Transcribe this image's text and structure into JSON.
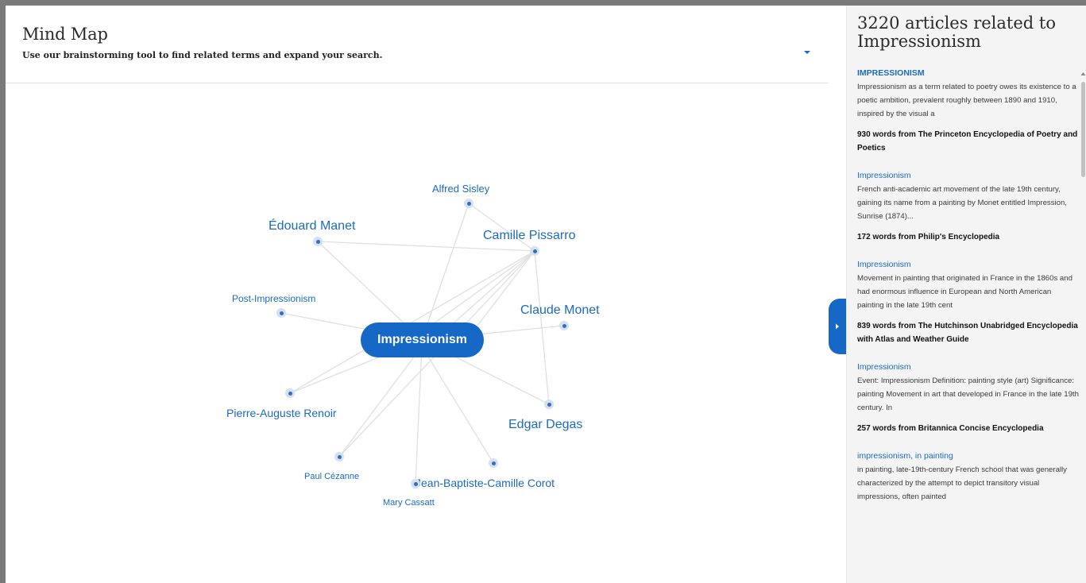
{
  "mindmap": {
    "title": "Mind Map",
    "subtitle": "Use our brainstorming tool to find related terms and expand your search.",
    "center": "Impressionism",
    "nodes": {
      "sisley": "Alfred Sisley",
      "manet": "Édouard Manet",
      "pissarro": "Camille Pissarro",
      "post": "Post-Impressionism",
      "monet": "Claude Monet",
      "renoir": "Pierre-Auguste Renoir",
      "degas": "Edgar Degas",
      "cezanne": "Paul Cézanne",
      "corot": "Jean-Baptiste-Camille Corot",
      "cassatt": "Mary Cassatt"
    },
    "icons": {
      "dropdown": "chevron-down-icon",
      "collapse": "chevron-right-icon"
    },
    "colors": {
      "accent": "#1668c7",
      "link": "#1a6bc2"
    }
  },
  "results": {
    "title": "3220 articles related to Impressionism",
    "articles": [
      {
        "title": "IMPRESSIONISM",
        "snippet": "Impressionism as a term related to poetry owes its existence to a poetic ambition, prevalent roughly between 1890 and 1910, inspired by the visual a",
        "source_count": "930",
        "source_text": "words from The Princeton Encyclopedia of Poetry and Poetics"
      },
      {
        "title": "Impressionism",
        "snippet": "French anti-academic art movement of the late 19th century, gaining its name from a painting by Monet entitled Impression, Sunrise (1874)...",
        "source_count": "172",
        "source_text": "words from Philip's Encyclopedia"
      },
      {
        "title": "Impressionism",
        "snippet": "Movement in painting that originated in France in the 1860s and had enormous influence in European and North American painting in the late 19th cent",
        "source_count": "839",
        "source_text": "words from The Hutchinson Unabridged Encyclopedia with Atlas and Weather Guide"
      },
      {
        "title": "Impressionism",
        "snippet": "Event: Impressionism Definition: painting style (art) Significance: painting Movement in art that developed in France in the late 19th century. In",
        "source_count": "257",
        "source_text": "words from Britannica Concise Encyclopedia"
      },
      {
        "title": "impressionism, in painting",
        "snippet": "in painting, late-19th-century French school that was generally characterized by the attempt to depict transitory visual impressions, often painted",
        "source_count": "",
        "source_text": ""
      }
    ]
  }
}
